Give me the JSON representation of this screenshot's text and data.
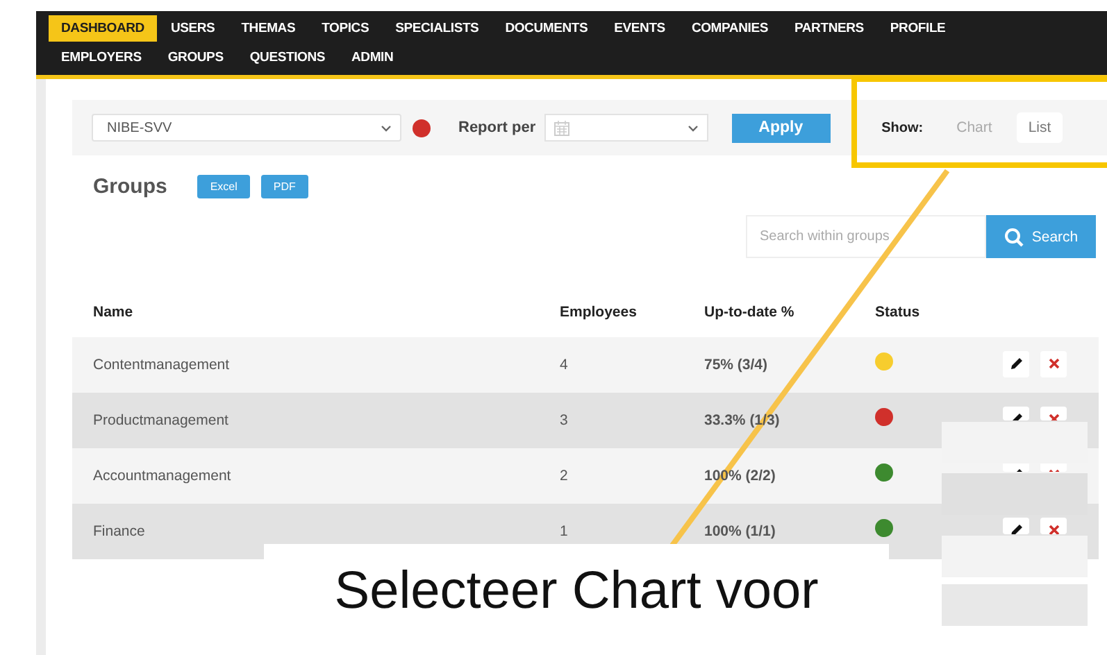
{
  "nav": {
    "items": [
      {
        "label": "DASHBOARD",
        "selected": true
      },
      {
        "label": "USERS",
        "selected": false
      },
      {
        "label": "THEMAS",
        "selected": false
      },
      {
        "label": "TOPICS",
        "selected": false
      },
      {
        "label": "SPECIALISTS",
        "selected": false
      },
      {
        "label": "DOCUMENTS",
        "selected": false
      },
      {
        "label": "EVENTS",
        "selected": false
      },
      {
        "label": "COMPANIES",
        "selected": false
      },
      {
        "label": "PARTNERS",
        "selected": false
      },
      {
        "label": "PROFILE",
        "selected": false
      },
      {
        "label": "EMPLOYERS",
        "selected": false
      },
      {
        "label": "GROUPS",
        "selected": false
      },
      {
        "label": "QUESTIONS",
        "selected": false
      },
      {
        "label": "ADMIN",
        "selected": false
      }
    ]
  },
  "filter": {
    "group_select": {
      "value": "NIBE-SVV"
    },
    "report_label": "Report per",
    "apply_button": "Apply",
    "show_label": "Show:",
    "show_options": [
      {
        "label": "Chart",
        "selected": false
      },
      {
        "label": "List",
        "selected": true
      }
    ]
  },
  "groups": {
    "title": "Groups",
    "exports": [
      "Excel",
      "PDF"
    ],
    "search": {
      "placeholder": "Search within groups",
      "button": "Search"
    },
    "table": {
      "columns": [
        "Name",
        "Employees",
        "Up-to-date %",
        "Status"
      ],
      "rows": [
        {
          "name": "Contentmanagement",
          "employees": "4",
          "up_to_date": "75% (3/4)",
          "color": "#f7cd2e"
        },
        {
          "name": "Productmanagement",
          "employees": "3",
          "up_to_date": "33.3% (1/3)",
          "color": "#d0302b"
        },
        {
          "name": "Accountmanagement",
          "employees": "2",
          "up_to_date": "100% (2/2)",
          "color": "#3d8a2f"
        },
        {
          "name": "Finance",
          "employees": "1",
          "up_to_date": "100% (1/1)",
          "color": "#3d8a2f"
        }
      ]
    }
  },
  "annotation": {
    "caption": "Selecteer Chart voor"
  }
}
